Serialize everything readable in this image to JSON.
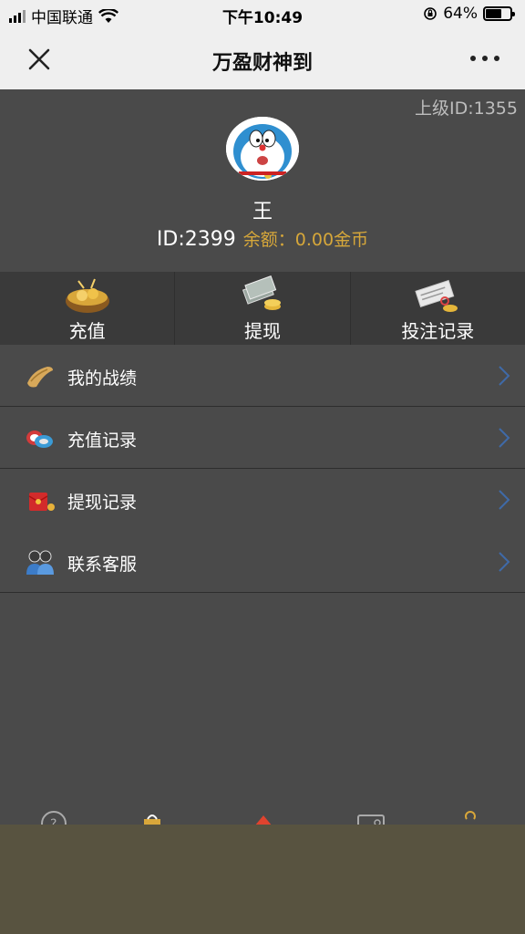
{
  "status_bar": {
    "carrier": "中国联通",
    "time": "下午10:49",
    "battery": "64%",
    "battery_level": 0.64
  },
  "nav": {
    "title": "万盈财神到"
  },
  "profile": {
    "parent_id": "上级ID:1355",
    "name": "王",
    "id": "ID:2399",
    "balance": "余额：0.00金币"
  },
  "actions": [
    {
      "label": "充值",
      "icon": "gold-pot-icon"
    },
    {
      "label": "提现",
      "icon": "cash-coins-icon"
    },
    {
      "label": "投注记录",
      "icon": "betting-slip-icon"
    }
  ],
  "menu": [
    {
      "label": "我的战绩",
      "icon": "scroll-icon"
    },
    {
      "label": "充值记录",
      "icon": "chips-icon"
    },
    {
      "label": "提现记录",
      "icon": "red-envelope-icon"
    },
    {
      "label": "联系客服",
      "icon": "customer-service-icon"
    }
  ],
  "colors": {
    "accent": "#d6a73a",
    "background": "#4a4a4a",
    "action_bar": "#3a3a3a",
    "chevron": "#3f6aa8"
  }
}
